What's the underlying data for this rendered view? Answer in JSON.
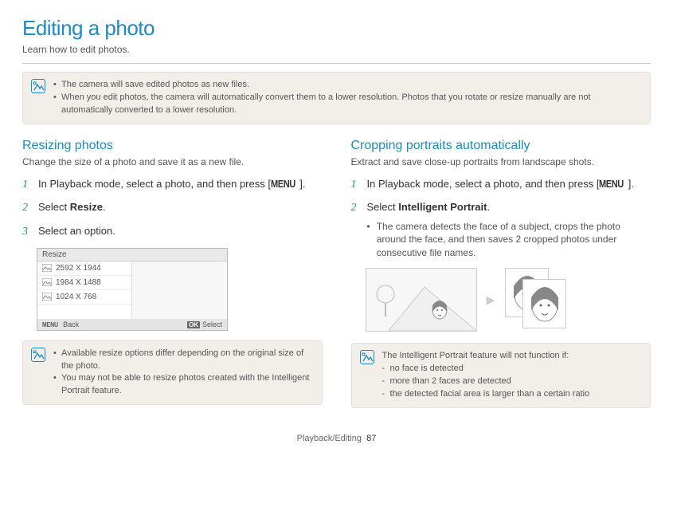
{
  "page": {
    "title": "Editing a photo",
    "subtitle": "Learn how to edit photos."
  },
  "top_notes": {
    "items": [
      "The camera will save edited photos as new files.",
      "When you edit photos, the camera will automatically convert them to a lower resolution. Photos that you rotate or resize manually are not automatically converted to a lower resolution."
    ]
  },
  "left": {
    "title": "Resizing photos",
    "sub": "Change the size of a photo and save it as a new file.",
    "step1_a": "In Playback mode, select a photo, and then press [",
    "step1_menu": "MENU",
    "step1_b": "].",
    "step2_a": "Select ",
    "step2_bold": "Resize",
    "step2_b": ".",
    "step3": "Select an option.",
    "screen": {
      "title": "Resize",
      "options": [
        "2592 X 1944",
        "1984 X 1488",
        "1024 X 768"
      ],
      "back_menu": "MENU",
      "back": "Back",
      "ok": "OK",
      "select": "Select"
    },
    "notes": {
      "items": [
        "Available resize options differ depending on the original size of the photo.",
        "You may not be able to resize photos created with the Intelligent Portrait feature."
      ]
    }
  },
  "right": {
    "title": "Cropping portraits automatically",
    "sub": "Extract and save close-up portraits from landscape shots.",
    "step1_a": "In Playback mode, select a photo, and then press [",
    "step1_menu": "MENU",
    "step1_b": "].",
    "step2_a": "Select ",
    "step2_bold": "Intelligent Portrait",
    "step2_b": ".",
    "step2_bullet": "The camera detects the face of a subject, crops the photo around the face, and then saves 2 cropped photos under consecutive file names.",
    "notes": {
      "lead": "The Intelligent Portrait feature will not function if:",
      "items": [
        "no face is detected",
        "more than 2 faces are detected",
        "the detected facial area is larger than a certain ratio"
      ]
    }
  },
  "footer": {
    "section": "Playback/Editing",
    "page": "87"
  }
}
